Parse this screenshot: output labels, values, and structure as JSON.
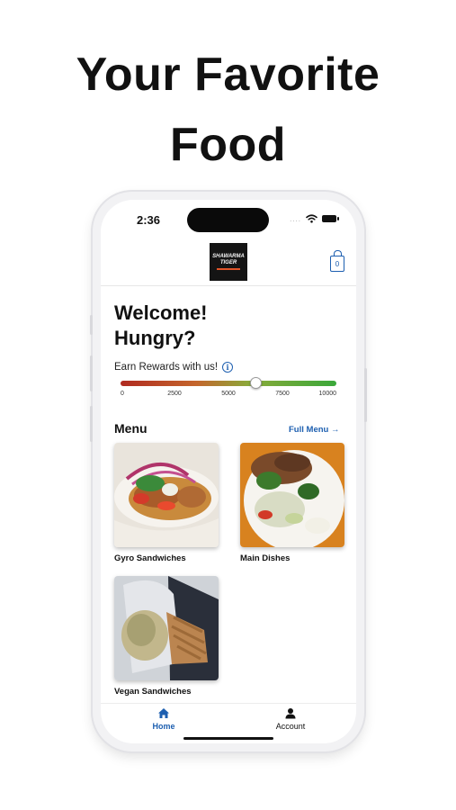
{
  "headline": {
    "line1": "Your Favorite",
    "line2": "Food"
  },
  "status_bar": {
    "time": "2:36",
    "dots": "....",
    "icons": [
      "wifi-icon",
      "battery-icon"
    ]
  },
  "header": {
    "logo": {
      "line1": "SHAWARMA",
      "line2": "TIGER"
    },
    "bag": {
      "icon": "shopping-bag-icon",
      "count": "0"
    }
  },
  "welcome": {
    "line1": "Welcome!",
    "line2": "Hungry?"
  },
  "rewards": {
    "label": "Earn Rewards with us!",
    "info_icon": "i",
    "ticks": [
      "0",
      "2500",
      "5000",
      "7500",
      "10000"
    ],
    "min": 0,
    "max": 10000,
    "value": 6250
  },
  "menu": {
    "title": "Menu",
    "full_menu_label": "Full Menu →",
    "items": [
      {
        "label": "Gyro Sandwiches"
      },
      {
        "label": "Main Dishes"
      },
      {
        "label": "Vegan Sandwiches"
      }
    ]
  },
  "tabbar": {
    "tabs": [
      {
        "label": "Home",
        "icon": "home-icon",
        "active": true
      },
      {
        "label": "Account",
        "icon": "account-icon",
        "active": false
      }
    ]
  },
  "colors": {
    "accent": "#1d5fb0",
    "text": "#111111",
    "active_tab": "#1d5fb0"
  }
}
